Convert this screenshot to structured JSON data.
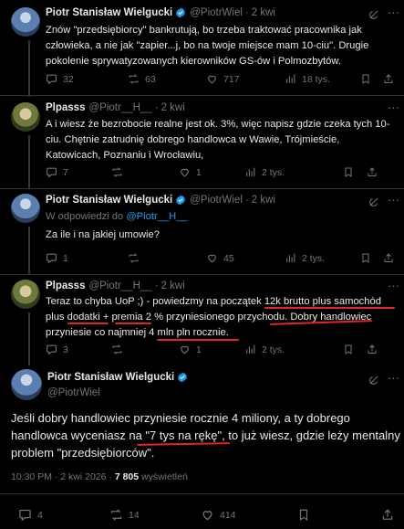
{
  "tweet1": {
    "name": "Piotr Stanisław Wielgucki",
    "handle": "@PiotrWiel",
    "time": "2 kwi",
    "text": "Znów \"przedsiębiorcy\" bankrutują, bo trzeba traktować pracownika jak człowieka, a nie jak \"zapier...j, bo na twoje miejsce mam 10-ciu\". Drugie pokolenie sprywatyzowanych kierowników GS-ów i Polmozbytów.",
    "stats": {
      "replies": "32",
      "reposts": "63",
      "likes": "717",
      "views": "18 tys."
    }
  },
  "tweet2": {
    "name": "Plpasss",
    "handle": "@Piotr__H__",
    "time": "2 kwi",
    "text": "A i wiesz że bezrobocie realne jest ok. 3%, więc napisz gdzie czeka tych 10-ciu. Chętnie zatrudnię dobrego handlowca w Wawie, Trójmieście, Katowicach, Poznaniu i Wrocławiu,",
    "stats": {
      "replies": "7",
      "reposts": "",
      "likes": "1",
      "views": "2 tys."
    }
  },
  "tweet3": {
    "name": "Piotr Stanisław Wielgucki",
    "handle": "@PiotrWiel",
    "time": "2 kwi",
    "reply_prefix": "W odpowiedzi do",
    "reply_to": "@Piotr__H__",
    "text": "Za ile i na jakiej umowie?",
    "stats": {
      "replies": "1",
      "reposts": "",
      "likes": "45",
      "views": "2 tys."
    }
  },
  "tweet4": {
    "name": "Plpasss",
    "handle": "@Piotr__H__",
    "time": "2 kwi",
    "lines": [
      "Teraz to chyba UoP ;) - powiedzmy na początek 12k brutto plus samochód",
      "plus dodatki + premia 2 % przyniesionego przychodu. Dobry handlowiec",
      "przyniesie  co najmniej 4 mln pln rocznie."
    ],
    "stats": {
      "replies": "3",
      "reposts": "",
      "likes": "1",
      "views": "2 tys."
    }
  },
  "main": {
    "name": "Piotr Stanisław Wielgucki",
    "handle": "@PiotrWiel",
    "line1": "Jeśli dobry handlowiec przyniesie rocznie 4 miliony, a ty dobrego",
    "line2_a": "handlowca wyceniasz na ",
    "line2_q": "\"7 tys na rękę\"",
    "line2_b": ", to już wiesz, gdzie leży mentalny",
    "line3": "problem \"przedsiębiorców\".",
    "time": "10:30 PM · 2 kwi 2026 · ",
    "views_count": "7 805",
    "views_label": " wyświetleń",
    "stats": {
      "replies": "4",
      "reposts": "14",
      "likes": "414"
    }
  },
  "colors": {
    "accent": "#1d9bf0",
    "underline": "#e0262b"
  }
}
